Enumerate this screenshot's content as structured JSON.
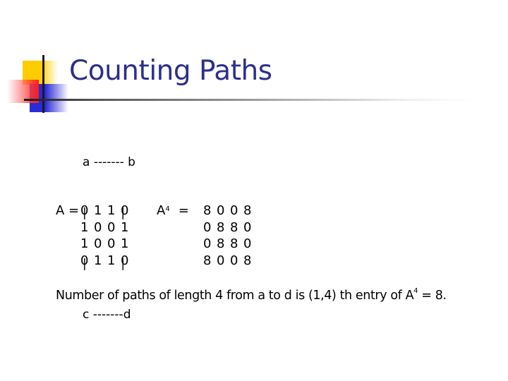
{
  "slide": {
    "title": "Counting Paths",
    "graph_diagram": {
      "lines": [
        "a ------- b",
        "|         |",
        "|         |",
        "c -------d"
      ]
    },
    "matrix_A": {
      "label": "A = ",
      "rows": [
        [
          "0",
          "1",
          "1",
          "0"
        ],
        [
          "1",
          "0",
          "0",
          "1"
        ],
        [
          "1",
          "0",
          "0",
          "1"
        ],
        [
          "0",
          "1",
          "1",
          "0"
        ]
      ]
    },
    "matrix_A4": {
      "base": "A",
      "exponent": "4",
      "equals": "=",
      "rows": [
        [
          "8",
          "0",
          "0",
          "8"
        ],
        [
          "0",
          "8",
          "8",
          "0"
        ],
        [
          "0",
          "8",
          "8",
          "0"
        ],
        [
          "8",
          "0",
          "0",
          "8"
        ]
      ]
    },
    "conclusion": {
      "text_before": "Number of paths of length 4 from a to d is (1,4) th entry of A",
      "exponent": "4",
      "text_after": " = 8."
    },
    "colors": {
      "title": "#2e2e8c",
      "accent_yellow": "#ffcc00",
      "accent_blue": "#2b2bd6",
      "accent_red": "#ff1a1a"
    }
  }
}
